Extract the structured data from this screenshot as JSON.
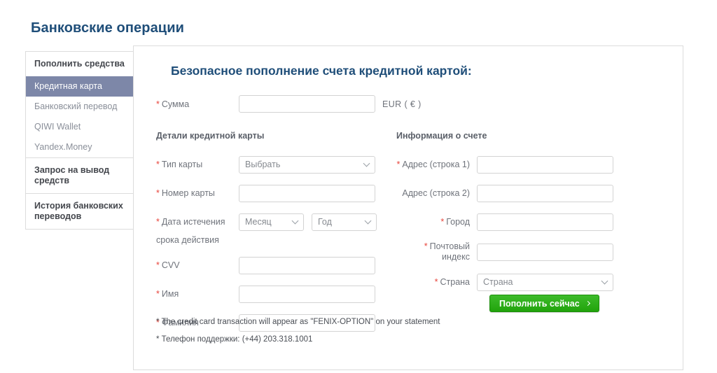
{
  "page": {
    "title": "Банковские операции"
  },
  "sidebar": {
    "groups": [
      {
        "header": "Пополнить средства",
        "items": [
          {
            "label": "Кредитная карта",
            "active": true
          },
          {
            "label": "Банковский перевод",
            "active": false
          },
          {
            "label": "QIWI Wallet",
            "active": false
          },
          {
            "label": "Yandex.Money",
            "active": false
          }
        ]
      },
      {
        "header": "Запрос на вывод средств",
        "items": []
      },
      {
        "header": "История банковских переводов",
        "items": []
      }
    ]
  },
  "form": {
    "heading": "Безопасное пополнение счета кредитной картой:",
    "amount": {
      "label": "Сумма",
      "required_mark": "*",
      "value": "",
      "placeholder": "",
      "currency": "EUR ( € )"
    },
    "card_section": {
      "title": "Детали кредитной карты",
      "fields": {
        "card_type": {
          "label": "Тип карты",
          "required_mark": "*",
          "selected": "Выбрать"
        },
        "card_number": {
          "label": "Номер карты",
          "required_mark": "*",
          "value": "",
          "placeholder": ""
        },
        "expiry": {
          "label": "Дата истечения",
          "label_line2": "срока действия",
          "required_mark": "*",
          "month_selected": "Месяц",
          "year_selected": "Год"
        },
        "cvv": {
          "label": "CVV",
          "required_mark": "*",
          "value": "",
          "placeholder": ""
        },
        "first_name": {
          "label": "Имя",
          "required_mark": "*",
          "value": "",
          "placeholder": ""
        },
        "last_name": {
          "label": "Фамилия",
          "required_mark": "*",
          "value": "",
          "placeholder": ""
        }
      }
    },
    "account_section": {
      "title": "Информация о счете",
      "fields": {
        "address1": {
          "label": "Адрес (строка 1)",
          "required_mark": "*",
          "value": "",
          "placeholder": ""
        },
        "address2": {
          "label": "Адрес (строка 2)",
          "required_mark": "",
          "value": "",
          "placeholder": ""
        },
        "city": {
          "label": "Город",
          "required_mark": "*",
          "value": "",
          "placeholder": ""
        },
        "postcode": {
          "label": "Почтовый индекс",
          "required_mark": "*",
          "value": "",
          "placeholder": ""
        },
        "country": {
          "label": "Страна",
          "required_mark": "*",
          "selected": "Страна"
        }
      }
    },
    "submit": {
      "label": "Пополнить сейчас",
      "icon": "chevron-right-icon"
    },
    "notes": [
      "* The credit card transaction will appear as \"FENIX-OPTION\" on your statement",
      "* Телефон поддержки: (+44) 203.318.1001"
    ]
  },
  "colors": {
    "title_blue": "#1f4e79",
    "active_item": "#7d87a8",
    "required_red": "#e8453c",
    "submit_green": "#21a30c",
    "border_gray": "#dcdcdc"
  }
}
